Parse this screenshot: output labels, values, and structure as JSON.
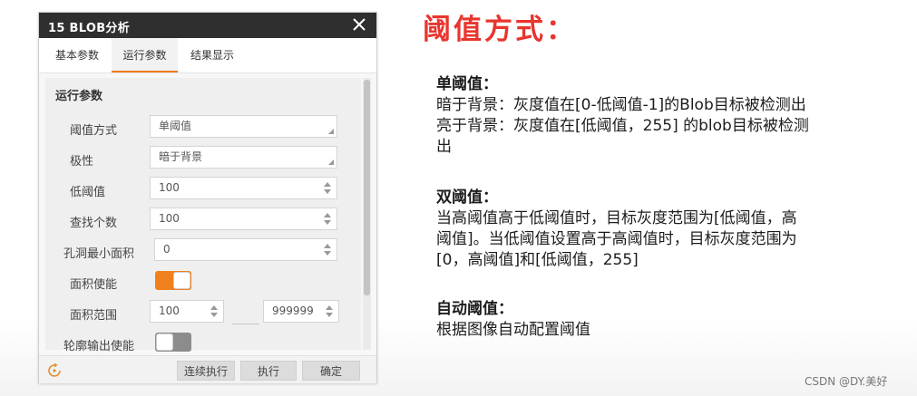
{
  "dialog": {
    "title": "15 BLOB分析",
    "tabs": [
      {
        "label": "基本参数",
        "active": false
      },
      {
        "label": "运行参数",
        "active": true
      },
      {
        "label": "结果显示",
        "active": false
      }
    ],
    "section_title": "运行参数",
    "fields": {
      "threshold_mode": {
        "label": "阈值方式",
        "value": "单阈值"
      },
      "polarity": {
        "label": "极性",
        "value": "暗于背景"
      },
      "low_threshold": {
        "label": "低阈值",
        "value": "100"
      },
      "find_count": {
        "label": "查找个数",
        "value": "100"
      },
      "hole_min_area": {
        "label": "孔洞最小面积",
        "value": "0"
      },
      "area_enable": {
        "label": "面积使能",
        "on": true
      },
      "area_range": {
        "label": "面积范围",
        "min": "100",
        "max": "999999"
      },
      "contour_output": {
        "label": "轮廓输出使能",
        "on": false
      }
    },
    "buttons": {
      "continuous": "连续执行",
      "execute": "执行",
      "confirm": "确定"
    },
    "accent_color": "#f0801d",
    "titlebar_color": "#2f2f2f"
  },
  "explanation": {
    "heading": "阈值方式：",
    "heading_color": "#e8352e",
    "single": {
      "title": "单阈值：",
      "lines": [
        "暗于背景：灰度值在[0-低阈值-1]的Blob目标被检测出",
        "亮于背景：灰度值在[低阈值，255] 的blob目标被检测",
        "出"
      ]
    },
    "double": {
      "title": "双阈值：",
      "lines": [
        "当高阈值高于低阈值时，目标灰度范围为[低阈值，高",
        "阈值]。当低阈值设置高于高阈值时，目标灰度范围为",
        "[0，高阈值]和[低阈值，255]"
      ]
    },
    "auto": {
      "title": "自动阈值：",
      "lines": [
        "根据图像自动配置阈值"
      ]
    }
  },
  "watermark": "CSDN @DY.美好"
}
